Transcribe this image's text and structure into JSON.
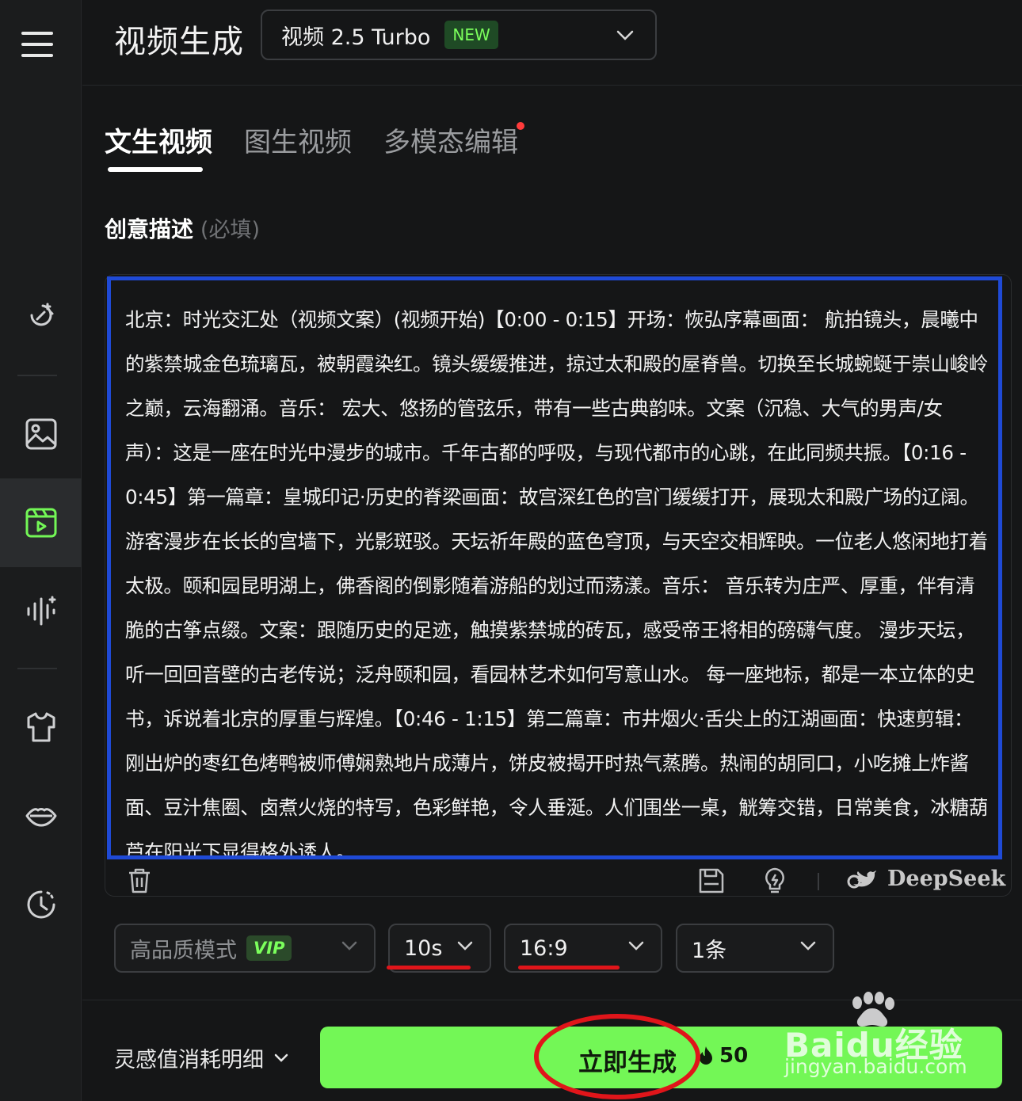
{
  "header": {
    "title": "视频生成",
    "model": {
      "name": "视频 2.5 Turbo",
      "badge": "NEW"
    }
  },
  "sidebar": {
    "items": [
      {
        "icon": "magic-wand-icon"
      },
      {
        "icon": "image-icon"
      },
      {
        "icon": "video-icon",
        "active": true
      },
      {
        "icon": "audio-wave-icon"
      },
      {
        "icon": "tshirt-icon"
      },
      {
        "icon": "lips-icon"
      },
      {
        "icon": "history-clock-icon"
      }
    ]
  },
  "tabs": [
    {
      "label": "文生视频",
      "active": true
    },
    {
      "label": "图生视频"
    },
    {
      "label": "多模态编辑"
    }
  ],
  "prompt": {
    "label": "创意描述",
    "required_hint": "(必填)",
    "text": "北京：时光交汇处（视频文案）(视频开始)【0:00 - 0:15】开场：恢弘序幕画面： 航拍镜头，晨曦中的紫禁城金色琉璃瓦，被朝霞染红。镜头缓缓推进，掠过太和殿的屋脊兽。切换至长城蜿蜒于崇山峻岭之巅，云海翻涌。音乐： 宏大、悠扬的管弦乐，带有一些古典韵味。文案（沉稳、大气的男声/女声）：这是一座在时光中漫步的城市。千年古都的呼吸，与现代都市的心跳，在此同频共振。【0:16 - 0:45】第一篇章：皇城印记·历史的脊梁画面：故宫深红色的宫门缓缓打开，展现太和殿广场的辽阔。游客漫步在长长的宫墙下，光影斑驳。天坛祈年殿的蓝色穹顶，与天空交相辉映。一位老人悠闲地打着太极。颐和园昆明湖上，佛香阁的倒影随着游船的划过而荡漾。音乐： 音乐转为庄严、厚重，伴有清脆的古筝点缀。文案：跟随历史的足迹，触摸紫禁城的砖瓦，感受帝王将相的磅礴气度。 漫步天坛，听一回回音壁的古老传说；泛舟颐和园，看园林艺术如何写意山水。 每一座地标，都是一本立体的史书，诉说着北京的厚重与辉煌。【0:46 - 1:15】第二篇章：市井烟火·舌尖上的江湖画面：快速剪辑： 刚出炉的枣红色烤鸭被师傅娴熟地片成薄片，饼皮被揭开时热气蒸腾。热闹的胡同口，小吃摊上炸酱面、豆汁焦圈、卤煮火烧的特写，色彩鲜艳，令人垂涎。人们围坐一桌，觥筹交错，日常美食，冰糖葫芦在阳光下显得格外诱人。"
  },
  "editor_tools": {
    "delete_icon": "trash-icon",
    "save_icon": "save-icon",
    "inspire_icon": "lightbulb-icon",
    "deepseek_label": "DeepSeek"
  },
  "options": {
    "quality": {
      "label": "高品质模式",
      "badge": "VIP"
    },
    "duration": "10s",
    "ratio": "16:9",
    "count": "1条"
  },
  "footer": {
    "cost_detail": "灵感值消耗明细",
    "generate_label": "立即生成",
    "cost": "50"
  },
  "watermark": {
    "brand": "Baidu经验",
    "url": "jingyan.baidu.com"
  },
  "colors": {
    "accent_green": "#73f756",
    "highlight_blue": "#1f4ad6",
    "annotation_red": "#e0151a",
    "background": "#151617"
  }
}
